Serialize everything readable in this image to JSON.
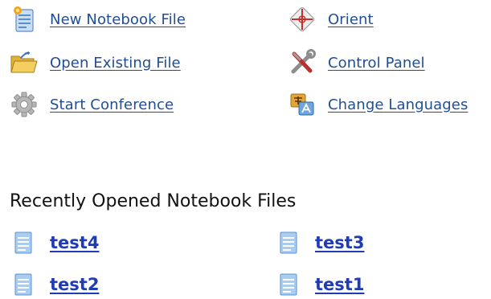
{
  "actions": {
    "new_notebook": {
      "label": "New Notebook File",
      "icon": "new-document-icon"
    },
    "open_existing": {
      "label": "Open Existing File",
      "icon": "open-folder-icon"
    },
    "start_conference": {
      "label": "Start Conference",
      "icon": "gear-icon"
    },
    "orient": {
      "label": "Orient",
      "icon": "crosshair-icon"
    },
    "control_panel": {
      "label": "Control Panel",
      "icon": "tools-icon"
    },
    "change_languages": {
      "label": "Change Languages",
      "icon": "language-icon"
    }
  },
  "recent": {
    "title": "Recently Opened Notebook Files",
    "files": [
      "test4",
      "test3",
      "test2",
      "test1"
    ]
  },
  "colors": {
    "link": "#1f4e94",
    "recent_link": "#1f3bb5",
    "title": "#111111"
  }
}
